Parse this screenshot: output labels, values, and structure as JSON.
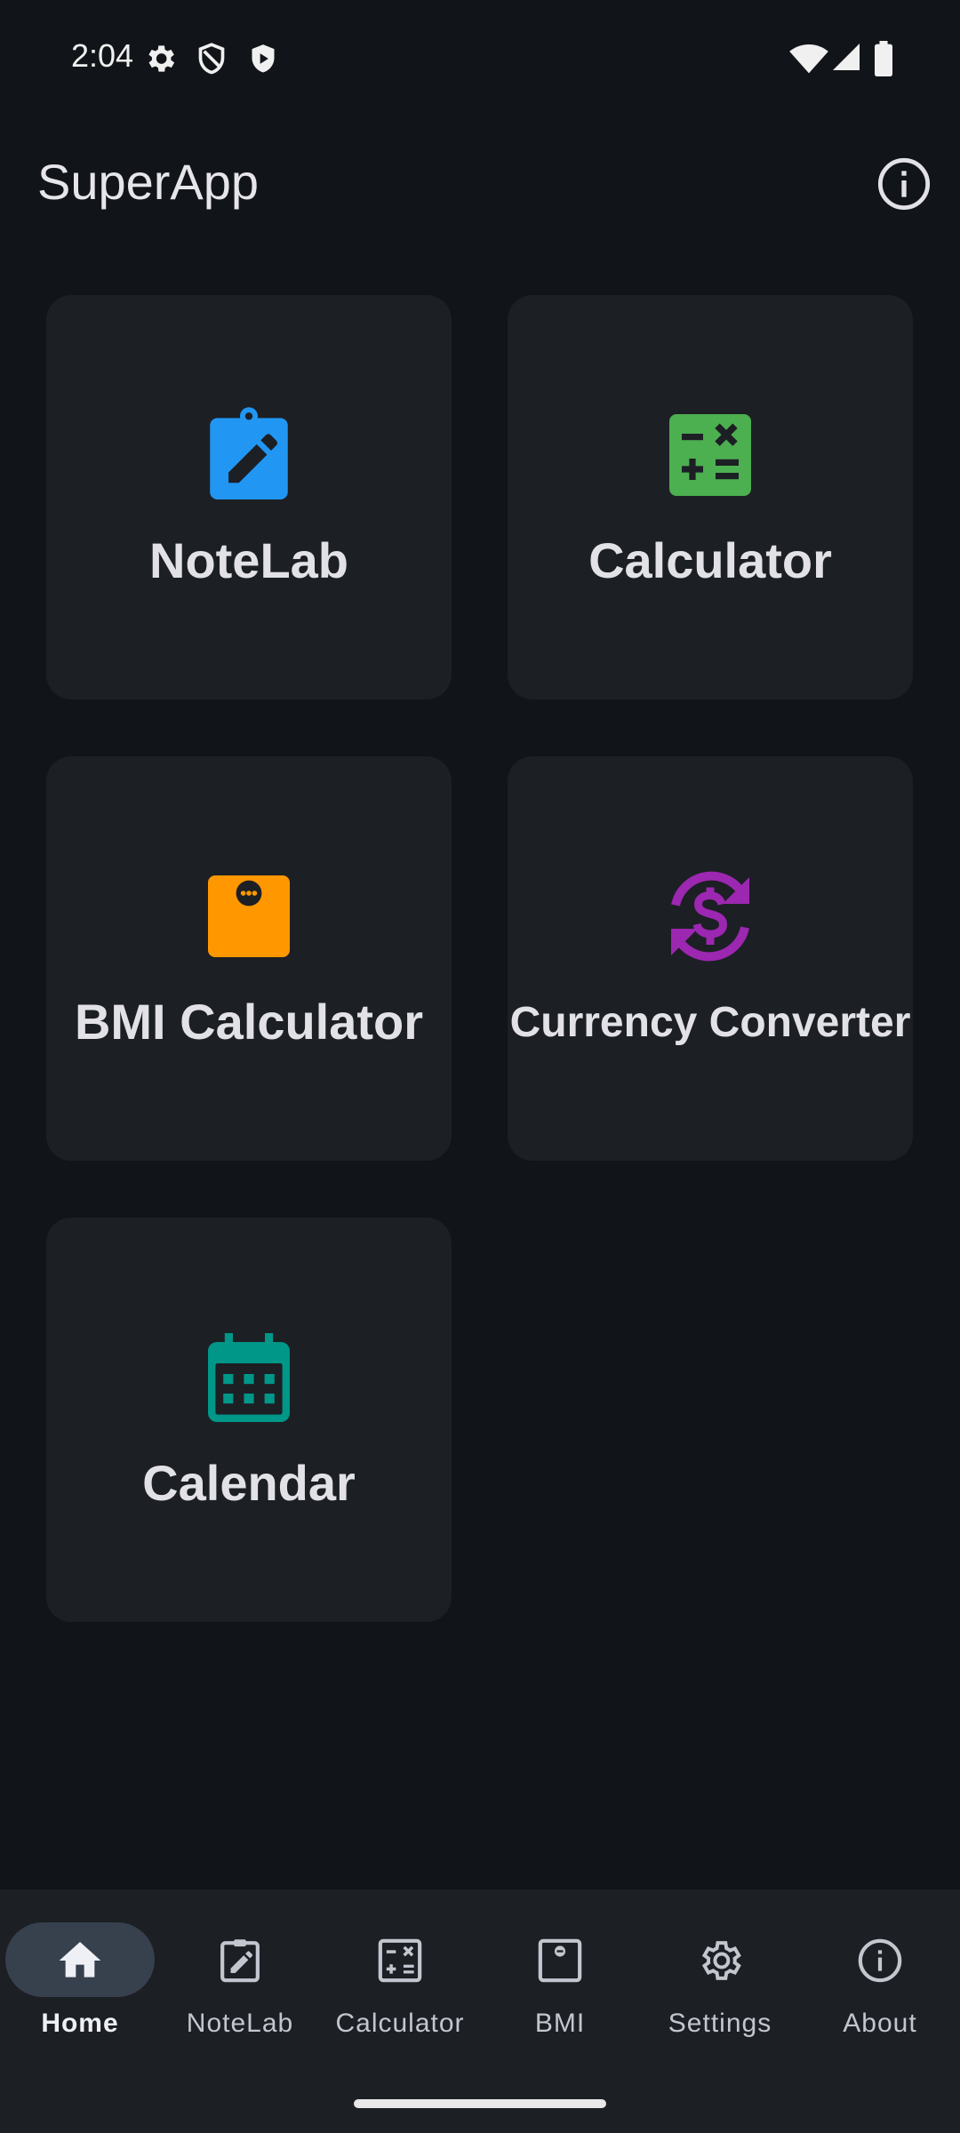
{
  "status_bar": {
    "time": "2:04",
    "icons": [
      "settings-icon",
      "shield-icon",
      "shield-play-icon",
      "wifi-icon",
      "signal-icon",
      "battery-icon"
    ]
  },
  "app_bar": {
    "title": "SuperApp",
    "action_icon": "info-icon"
  },
  "tiles": [
    {
      "label": "NoteLab",
      "icon": "clipboard-edit-icon",
      "color": "#2196F3"
    },
    {
      "label": "Calculator",
      "icon": "calculator-icon",
      "color": "#4CAF50"
    },
    {
      "label": "BMI Calculator",
      "icon": "scale-icon",
      "color": "#FF9800"
    },
    {
      "label": "Currency Converter",
      "icon": "currency-exchange-icon",
      "color": "#9C27B0"
    },
    {
      "label": "Calendar",
      "icon": "calendar-icon",
      "color": "#009688"
    }
  ],
  "bottom_nav": {
    "items": [
      {
        "label": "Home",
        "icon": "home-icon",
        "active": true
      },
      {
        "label": "NoteLab",
        "icon": "clipboard-edit-icon"
      },
      {
        "label": "Calculator",
        "icon": "calculator-icon"
      },
      {
        "label": "BMI",
        "icon": "scale-icon"
      },
      {
        "label": "Settings",
        "icon": "gear-icon"
      },
      {
        "label": "About",
        "icon": "info-icon"
      }
    ]
  }
}
